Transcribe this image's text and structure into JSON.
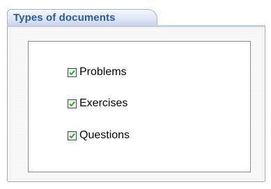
{
  "panel": {
    "tab_label": "Types of documents",
    "options": [
      {
        "label": "Problems",
        "checked": true
      },
      {
        "label": "Exercises",
        "checked": true
      },
      {
        "label": "Questions",
        "checked": true
      }
    ]
  },
  "colors": {
    "tab_text": "#2a5d99",
    "checkbox_border": "#1c5180",
    "checkmark": "#21a121"
  }
}
